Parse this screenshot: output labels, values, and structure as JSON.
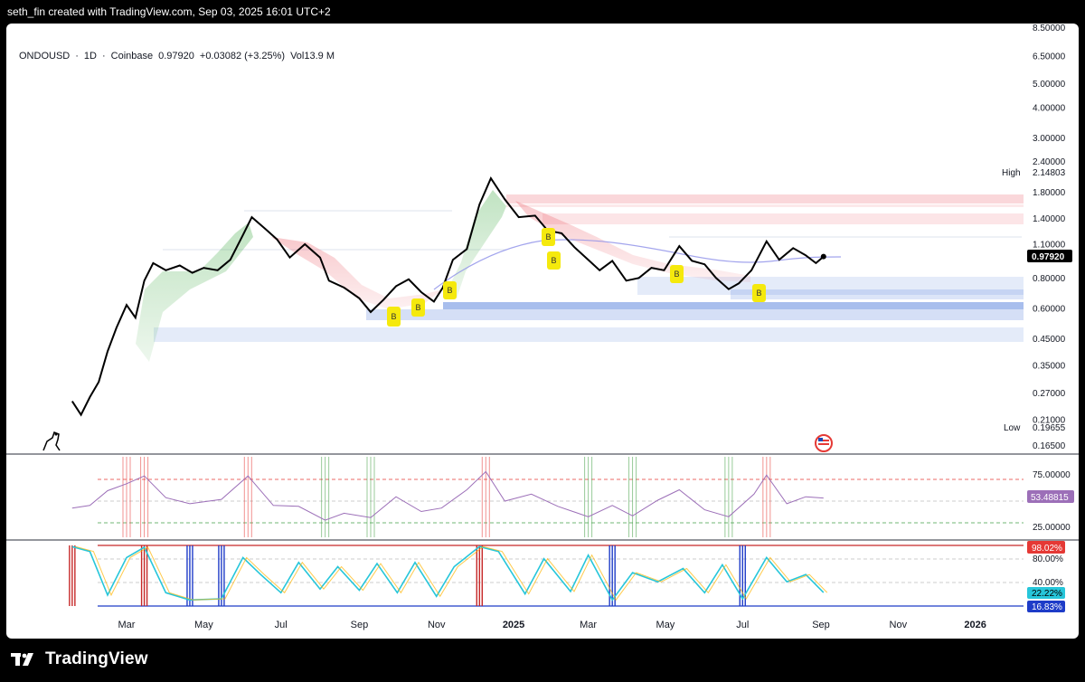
{
  "header": {
    "text": "seth_fin created with TradingView.com, Sep 03, 2025 16:01 UTC+2"
  },
  "legend": {
    "symbol": "ONDOUSD",
    "sep1": "·",
    "interval": "1D",
    "sep2": "·",
    "exchange": "Coinbase",
    "price": "0.97920",
    "change": "+0.03082 (+3.25%)",
    "volume": "Vol13.9 M"
  },
  "brand": {
    "name": "TradingView"
  },
  "colors": {
    "price_line": "#000000",
    "rsi_line": "#9c6fb8",
    "overbought": "#e53935",
    "oversold": "#43a047",
    "demand_zone": "#3f6fd8",
    "supply_zone": "#e84a55",
    "buy_marker": "#f5e90d"
  },
  "chart_data": [
    {
      "type": "line",
      "title": "ONDOUSD · 1D · Coinbase",
      "scale": "log",
      "yticks": [
        "8.50000",
        "6.50000",
        "5.00000",
        "4.00000",
        "3.00000",
        "2.40000",
        "1.80000",
        "1.40000",
        "1.10000",
        "0.80000",
        "0.60000",
        "0.45000",
        "0.35000",
        "0.27000",
        "0.21000",
        "0.16500"
      ],
      "xticks": [
        "Mar",
        "May",
        "Jul",
        "Sep",
        "Nov",
        "2025",
        "Mar",
        "May",
        "Jul",
        "Sep",
        "Nov",
        "2026"
      ],
      "ylim": [
        0.165,
        8.5
      ],
      "high": {
        "label": "High",
        "value": "2.14803"
      },
      "low": {
        "label": "Low",
        "value": "0.19655"
      },
      "last": {
        "value": "0.97920"
      },
      "series": [
        {
          "values": [
            [
              "2024-01-18",
              0.25
            ],
            [
              "2024-01-25",
              0.22
            ],
            [
              "2024-02-01",
              0.26
            ],
            [
              "2024-02-08",
              0.3
            ],
            [
              "2024-02-15",
              0.4
            ],
            [
              "2024-02-22",
              0.5
            ],
            [
              "2024-03-01",
              0.62
            ],
            [
              "2024-03-08",
              0.55
            ],
            [
              "2024-03-15",
              0.78
            ],
            [
              "2024-03-22",
              0.92
            ],
            [
              "2024-04-01",
              0.86
            ],
            [
              "2024-04-12",
              0.9
            ],
            [
              "2024-04-22",
              0.84
            ],
            [
              "2024-05-01",
              0.88
            ],
            [
              "2024-05-12",
              0.86
            ],
            [
              "2024-05-22",
              0.95
            ],
            [
              "2024-06-01",
              1.2
            ],
            [
              "2024-06-08",
              1.42
            ],
            [
              "2024-06-18",
              1.28
            ],
            [
              "2024-06-28",
              1.15
            ],
            [
              "2024-07-08",
              0.97
            ],
            [
              "2024-07-20",
              1.1
            ],
            [
              "2024-08-01",
              0.97
            ],
            [
              "2024-08-08",
              0.78
            ],
            [
              "2024-08-20",
              0.73
            ],
            [
              "2024-09-01",
              0.66
            ],
            [
              "2024-09-10",
              0.58
            ],
            [
              "2024-09-20",
              0.65
            ],
            [
              "2024-09-30",
              0.74
            ],
            [
              "2024-10-10",
              0.79
            ],
            [
              "2024-10-20",
              0.7
            ],
            [
              "2024-10-30",
              0.64
            ],
            [
              "2024-11-06",
              0.73
            ],
            [
              "2024-11-14",
              0.95
            ],
            [
              "2024-11-25",
              1.05
            ],
            [
              "2024-12-05",
              1.6
            ],
            [
              "2024-12-14",
              2.05
            ],
            [
              "2024-12-25",
              1.68
            ],
            [
              "2025-01-05",
              1.42
            ],
            [
              "2025-01-18",
              1.44
            ],
            [
              "2025-01-28",
              1.25
            ],
            [
              "2025-02-08",
              1.22
            ],
            [
              "2025-02-18",
              1.07
            ],
            [
              "2025-03-01",
              0.95
            ],
            [
              "2025-03-10",
              0.86
            ],
            [
              "2025-03-20",
              0.94
            ],
            [
              "2025-03-31",
              0.78
            ],
            [
              "2025-04-10",
              0.8
            ],
            [
              "2025-04-20",
              0.88
            ],
            [
              "2025-04-30",
              0.86
            ],
            [
              "2025-05-12",
              1.08
            ],
            [
              "2025-05-22",
              0.94
            ],
            [
              "2025-06-01",
              0.91
            ],
            [
              "2025-06-10",
              0.8
            ],
            [
              "2025-06-20",
              0.72
            ],
            [
              "2025-06-28",
              0.76
            ],
            [
              "2025-07-08",
              0.86
            ],
            [
              "2025-07-20",
              1.13
            ],
            [
              "2025-07-30",
              0.95
            ],
            [
              "2025-08-10",
              1.06
            ],
            [
              "2025-08-20",
              0.99
            ],
            [
              "2025-08-28",
              0.92
            ],
            [
              "2025-09-03",
              0.979
            ]
          ]
        }
      ]
    },
    {
      "type": "line",
      "title": "RSI",
      "yticks": [
        "75.00000",
        "25.00000"
      ],
      "last": "53.48815",
      "ylim": [
        15,
        90
      ],
      "series": [
        {
          "values": [
            [
              "2024-01-18",
              42
            ],
            [
              "2024-02-01",
              45
            ],
            [
              "2024-02-15",
              62
            ],
            [
              "2024-03-01",
              70
            ],
            [
              "2024-03-15",
              79
            ],
            [
              "2024-04-01",
              54
            ],
            [
              "2024-04-20",
              47
            ],
            [
              "2024-05-15",
              52
            ],
            [
              "2024-06-05",
              79
            ],
            [
              "2024-06-25",
              45
            ],
            [
              "2024-07-15",
              44
            ],
            [
              "2024-08-05",
              28
            ],
            [
              "2024-08-20",
              36
            ],
            [
              "2024-09-10",
              31
            ],
            [
              "2024-09-30",
              55
            ],
            [
              "2024-10-20",
              38
            ],
            [
              "2024-11-05",
              42
            ],
            [
              "2024-11-25",
              63
            ],
            [
              "2024-12-10",
              84
            ],
            [
              "2024-12-25",
              50
            ],
            [
              "2025-01-15",
              58
            ],
            [
              "2025-02-05",
              44
            ],
            [
              "2025-03-01",
              32
            ],
            [
              "2025-03-20",
              45
            ],
            [
              "2025-04-05",
              33
            ],
            [
              "2025-04-25",
              51
            ],
            [
              "2025-05-12",
              63
            ],
            [
              "2025-06-01",
              40
            ],
            [
              "2025-06-20",
              32
            ],
            [
              "2025-07-10",
              58
            ],
            [
              "2025-07-20",
              80
            ],
            [
              "2025-08-05",
              47
            ],
            [
              "2025-08-20",
              55
            ],
            [
              "2025-09-03",
              53.5
            ]
          ]
        }
      ]
    },
    {
      "type": "line",
      "title": "Stochastic",
      "yticks": [
        "80.00%",
        "40.00%"
      ],
      "labels": [
        "98.02%",
        "22.22%",
        "16.83%"
      ],
      "ylim": [
        0,
        100
      ],
      "series": [
        {
          "values": [
            [
              "2024-01-18",
              98
            ],
            [
              "2024-02-01",
              90
            ],
            [
              "2024-02-15",
              18
            ],
            [
              "2024-03-01",
              80
            ],
            [
              "2024-03-15",
              97
            ],
            [
              "2024-04-01",
              22
            ],
            [
              "2024-04-20",
              10
            ],
            [
              "2024-05-15",
              12
            ],
            [
              "2024-06-01",
              80
            ],
            [
              "2024-06-15",
              52
            ],
            [
              "2024-07-01",
              22
            ],
            [
              "2024-07-15",
              72
            ],
            [
              "2024-08-01",
              28
            ],
            [
              "2024-08-15",
              65
            ],
            [
              "2024-09-01",
              26
            ],
            [
              "2024-09-15",
              70
            ],
            [
              "2024-10-01",
              22
            ],
            [
              "2024-10-15",
              72
            ],
            [
              "2024-11-01",
              16
            ],
            [
              "2024-11-15",
              65
            ],
            [
              "2024-12-05",
              98
            ],
            [
              "2024-12-20",
              90
            ],
            [
              "2025-01-10",
              20
            ],
            [
              "2025-01-25",
              78
            ],
            [
              "2025-02-15",
              24
            ],
            [
              "2025-03-01",
              84
            ],
            [
              "2025-03-20",
              10
            ],
            [
              "2025-04-05",
              55
            ],
            [
              "2025-04-25",
              40
            ],
            [
              "2025-05-15",
              62
            ],
            [
              "2025-06-01",
              22
            ],
            [
              "2025-06-15",
              68
            ],
            [
              "2025-07-01",
              12
            ],
            [
              "2025-07-20",
              80
            ],
            [
              "2025-08-05",
              40
            ],
            [
              "2025-08-20",
              52
            ],
            [
              "2025-09-03",
              22.2
            ]
          ]
        }
      ]
    }
  ]
}
